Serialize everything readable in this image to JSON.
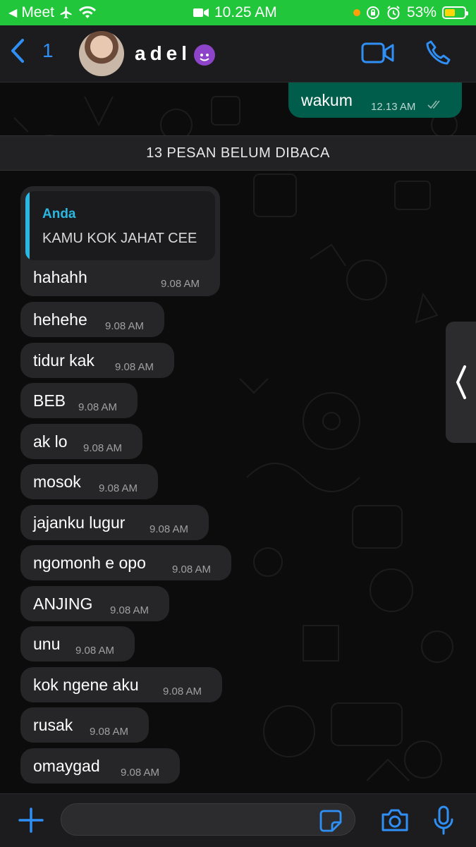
{
  "status_bar": {
    "back_app": "Meet",
    "time": "10.25 AM",
    "battery": "53%",
    "battery_level": 0.53
  },
  "header": {
    "back_count": "1",
    "contact_name": "adel",
    "contact_emoji": "smiling-devil-emoji"
  },
  "chat": {
    "outgoing": {
      "text": "wakum",
      "time": "12.13 AM"
    },
    "unread_banner": "13 PESAN BELUM DIBACA",
    "quoted_message": {
      "author": "Anda",
      "quote": "KAMU KOK JAHAT CEE",
      "text": "hahahh",
      "time": "9.08 AM"
    },
    "messages": [
      {
        "text": "hehehe",
        "time": "9.08 AM"
      },
      {
        "text": "tidur kak",
        "time": "9.08 AM"
      },
      {
        "text": "BEB",
        "time": "9.08 AM"
      },
      {
        "text": "ak lo",
        "time": "9.08 AM"
      },
      {
        "text": "mosok",
        "time": "9.08 AM"
      },
      {
        "text": "jajanku lugur",
        "time": "9.08 AM"
      },
      {
        "text": "ngomonh e opo",
        "time": "9.08 AM"
      },
      {
        "text": "ANJING",
        "time": "9.08 AM"
      },
      {
        "text": "unu",
        "time": "9.08 AM"
      },
      {
        "text": "kok ngene aku",
        "time": "9.08 AM"
      },
      {
        "text": "rusak",
        "time": "9.08 AM"
      },
      {
        "text": "omaygad",
        "time": "9.08 AM"
      }
    ]
  },
  "input_bar": {
    "message_value": ""
  },
  "colors": {
    "accent": "#2f8ff5",
    "status_bar": "#21c63b",
    "outgoing_bubble": "#005c4b",
    "incoming_bubble": "#262628",
    "quote_accent": "#2bb7e2"
  }
}
